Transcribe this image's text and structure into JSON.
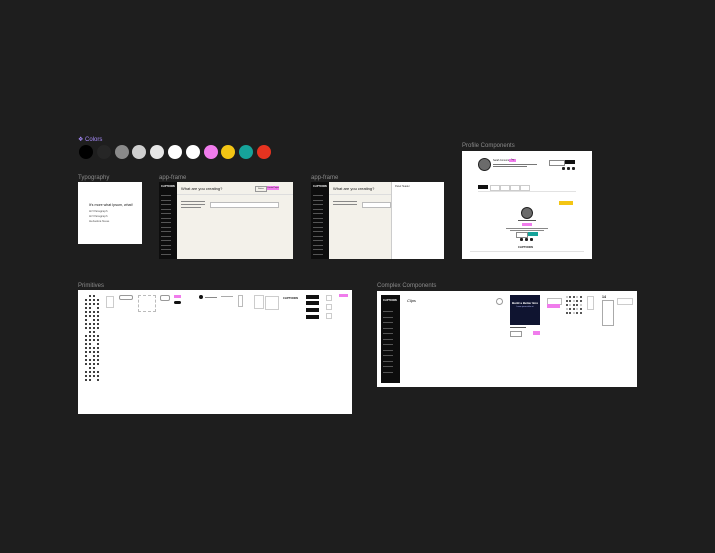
{
  "colors": {
    "label": "Colors",
    "swatches": [
      "#000000",
      "#262626",
      "#8a8a8a",
      "#cfcfcf",
      "#e6e6e6",
      "#ffffff",
      "#ffffff",
      "#f07cec",
      "#f3c514",
      "#16a39a",
      "#e63320"
    ]
  },
  "frames": {
    "typography": {
      "label": "Typography",
      "heading": "It's more what Ipsum, what!",
      "line1": "Hi! Paragraph",
      "line2": "Hi! Paragraph",
      "line3": "Helvetica Neue"
    },
    "app_frame_1": {
      "label": "app-frame",
      "logo": "CLIPTOONS",
      "title": "What are you creating?",
      "btn_outline": "Button",
      "btn_pink": "Create Project"
    },
    "app_frame_2": {
      "label": "app-frame",
      "logo": "CLIPTOONS",
      "title": "What are you creating?",
      "panel_title": "Panel Header"
    },
    "profile": {
      "label": "Profile Components",
      "name": "Sarah Connors",
      "badge": "Tag",
      "logo": "CLIPTOONS"
    },
    "primitives": {
      "label": "Primitives",
      "logo": "CLIPTOONS"
    },
    "complex": {
      "label": "Complex Components",
      "logo": "CLIPTOONS",
      "brand": "Clips",
      "card_title": "Build a Better Box",
      "card_sub": "Lorem ipsum dolor sit",
      "num": "14"
    }
  }
}
